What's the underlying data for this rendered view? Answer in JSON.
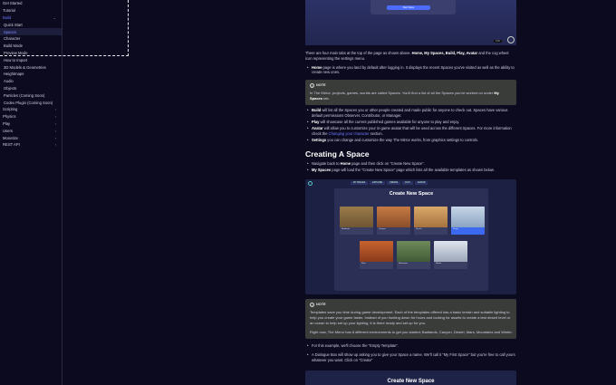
{
  "sidebar": {
    "items": [
      {
        "label": "Get Started",
        "chevron": false,
        "level": 0,
        "state": ""
      },
      {
        "label": "Tutorial",
        "chevron": false,
        "level": 0,
        "state": ""
      },
      {
        "label": "Build",
        "chevron": true,
        "level": 0,
        "state": "active"
      },
      {
        "label": "Quick Start",
        "chevron": false,
        "level": 1,
        "state": ""
      },
      {
        "label": "Spaces",
        "chevron": false,
        "level": 1,
        "state": "highlight"
      },
      {
        "label": "Character",
        "chevron": false,
        "level": 1,
        "state": ""
      },
      {
        "label": "Build Mode",
        "chevron": false,
        "level": 1,
        "state": ""
      },
      {
        "label": "Preview Mode",
        "chevron": false,
        "level": 1,
        "state": ""
      },
      {
        "label": "How to Import",
        "chevron": false,
        "level": 1,
        "state": ""
      },
      {
        "label": "3D Models & Geometries",
        "chevron": false,
        "level": 1,
        "state": ""
      },
      {
        "label": "Heightmaps",
        "chevron": false,
        "level": 1,
        "state": ""
      },
      {
        "label": "Audio",
        "chevron": false,
        "level": 1,
        "state": ""
      },
      {
        "label": "Objects",
        "chevron": false,
        "level": 1,
        "state": ""
      },
      {
        "label": "Particles (Coming Soon)",
        "chevron": false,
        "level": 1,
        "state": ""
      },
      {
        "label": "Codex Plugin (Coming Soon)",
        "chevron": false,
        "level": 1,
        "state": ""
      },
      {
        "label": "Scripting",
        "chevron": true,
        "level": 0,
        "state": ""
      },
      {
        "label": "Physics",
        "chevron": true,
        "level": 0,
        "state": ""
      },
      {
        "label": "Play",
        "chevron": true,
        "level": 0,
        "state": ""
      },
      {
        "label": "Users",
        "chevron": true,
        "level": 0,
        "state": ""
      },
      {
        "label": "Monetize",
        "chevron": true,
        "level": 0,
        "state": ""
      },
      {
        "label": "REST API",
        "chevron": true,
        "level": 0,
        "state": ""
      }
    ]
  },
  "top_screenshot": {
    "button_label": "Start Space",
    "controls_label": "0:00",
    "round_label": "..."
  },
  "intro": {
    "before": "There are four main tabs at the top of the page as shown above. ",
    "tabs": "Home, My Spaces, Build, Play, Avatar",
    "after": " and the cog wheel icon representing the settings menu."
  },
  "home_item": {
    "bold": "Home",
    "text": " page is where you land by default after logging in. It displays the recent Spaces you've visited as well as the ability to create new ones."
  },
  "note1": {
    "head": "NOTE",
    "text_before": "In The Mirror, projects, games, worlds are called Spaces. You'll find a list of all the Spaces you've worked on under ",
    "bold": "My Spaces",
    "text_after": " tab."
  },
  "tab_items": [
    {
      "bold": "Build",
      "text": " will list all the Spaces you or other people created and made public for anyone to check out. Spaces have various default permissions Observer, Contributor, or Manager."
    },
    {
      "bold": "Play",
      "text": " will showcase all the current published games available for anyone to play and enjoy."
    },
    {
      "bold": "Avatar",
      "text": " will allow you to customize your in-game avatar that will be used across the different Spaces. For more information check the ",
      "link": "Changing your character",
      "after": " section."
    },
    {
      "bold": "Settings",
      "text": " you can change and customize the way The Mirror works, from graphics settings to controls."
    }
  ],
  "section_title": "Creating A Space",
  "create_items": [
    {
      "text_before": "Navigate back to ",
      "bold": "Home",
      "text": " page and then click on \"Create New Space\"."
    },
    {
      "text_before": "",
      "bold": "My Spaces",
      "text": " page will load the \"Create New Space\" page which lists all the available templates as shown below."
    }
  ],
  "create_screenshot": {
    "tabs": [
      "MY SPACES",
      "EXPLORE",
      "CREATE",
      "PLAY",
      "AVATAR"
    ],
    "title": "Create New Space",
    "templates": [
      {
        "label": "Badlands",
        "color_top": "#9a7b4a",
        "color_bot": "#6f5532",
        "selected": false
      },
      {
        "label": "Canyon",
        "color_top": "#c77b44",
        "color_bot": "#8a4e2a",
        "selected": false
      },
      {
        "label": "Desert",
        "color_top": "#d9a86a",
        "color_bot": "#a6733d",
        "selected": false
      },
      {
        "label": "Empty",
        "color_top": "#c7d6e8",
        "color_bot": "#8aa3c2",
        "selected": true
      },
      {
        "label": "Mars",
        "color_top": "#c7632f",
        "color_bot": "#8a3a1c",
        "selected": false
      },
      {
        "label": "Mountains",
        "color_top": "#6f8a5a",
        "color_bot": "#415a36",
        "selected": false
      },
      {
        "label": "Winter",
        "color_top": "#dfe5ee",
        "color_bot": "#9aa6b8",
        "selected": false
      }
    ]
  },
  "note2": {
    "head": "NOTE",
    "p1": "Templates save you time during game development. Each of the templates offered has a basic terrain and suitable lighting to help you create your game faster. Instead of you hunting down for hours and looking for assets to create a test desert level or an ocean to help set up your lighting, it is there ready and set up for you.",
    "p2": "Right now, The Mirror has 8 different environments to get you started; Badlands, Canyon, Desert, Mars, Mountains and Winter."
  },
  "final_items": [
    {
      "text": "For this example, we'll choose the \"Empty Template\"."
    },
    {
      "text": "A Dialogue Box will show up asking you to give your Space a name. We'll call it \"My First Space\" but you're free to call yours whatever you want. Click on \"Create\""
    }
  ],
  "bottom_screenshot": {
    "title": "Create New Space"
  }
}
